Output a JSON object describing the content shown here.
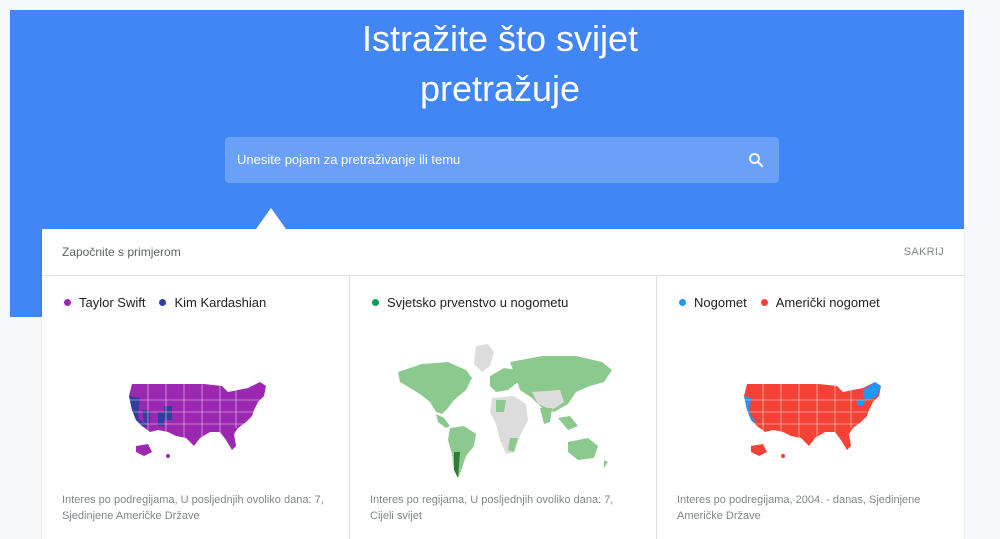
{
  "hero": {
    "title_line1": "Istražite što svijet",
    "title_line2": "pretražuje",
    "background": "#4285f4"
  },
  "search": {
    "placeholder": "Unesite pojam za pretraživanje ili temu",
    "icon": "search-icon"
  },
  "examples": {
    "header": "Započnite s primjerom",
    "hide_label": "SAKRIJ",
    "cards": [
      {
        "legend": [
          {
            "label": "Taylor Swift",
            "color": "#9c27b0"
          },
          {
            "label": "Kim Kardashian",
            "color": "#303f9f"
          }
        ],
        "map": "usa-map",
        "caption": "Interes po podregijama, U posljednjih ovoliko dana: 7, Sjedinjene Američke Države"
      },
      {
        "legend": [
          {
            "label": "Svjetsko prvenstvo u nogometu",
            "color": "#0f9d58"
          }
        ],
        "map": "world-map",
        "caption": "Interes po regijama, U posljednjih ovoliko dana: 7, Cijeli svijet"
      },
      {
        "legend": [
          {
            "label": "Nogomet",
            "color": "#2196f3"
          },
          {
            "label": "Američki nogomet",
            "color": "#f44336"
          }
        ],
        "map": "usa-map",
        "caption": "Interes po podregijama, 2004. - danas, Sjedinjene Američke Države"
      }
    ]
  }
}
